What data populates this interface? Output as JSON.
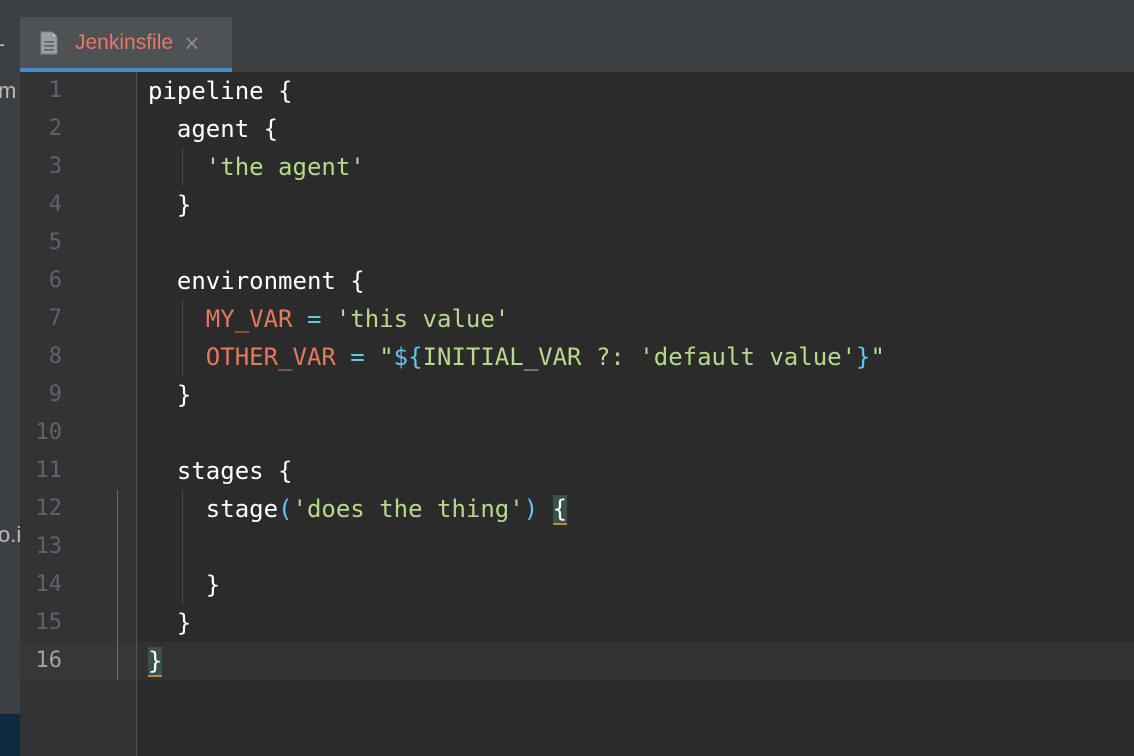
{
  "tabs": [
    {
      "title": "Jenkinsfile",
      "close": "×",
      "active": true
    }
  ],
  "left_panel": {
    "fragments": [
      "m",
      "o.i"
    ]
  },
  "editor": {
    "current_line": 16,
    "lines": [
      {
        "num": "1",
        "tokens": [
          [
            "plain",
            "pipeline {"
          ]
        ]
      },
      {
        "num": "2",
        "tokens": [
          [
            "plain",
            "  agent {"
          ]
        ]
      },
      {
        "num": "3",
        "tokens": [
          [
            "plain",
            "    "
          ],
          [
            "str",
            "'the agent'"
          ]
        ]
      },
      {
        "num": "4",
        "tokens": [
          [
            "plain",
            "  }"
          ]
        ]
      },
      {
        "num": "5",
        "tokens": []
      },
      {
        "num": "6",
        "tokens": [
          [
            "plain",
            "  environment {"
          ]
        ]
      },
      {
        "num": "7",
        "tokens": [
          [
            "plain",
            "    "
          ],
          [
            "var",
            "MY_VAR"
          ],
          [
            "plain",
            " "
          ],
          [
            "op",
            "="
          ],
          [
            "plain",
            " "
          ],
          [
            "str",
            "'this value'"
          ]
        ]
      },
      {
        "num": "8",
        "tokens": [
          [
            "plain",
            "    "
          ],
          [
            "var",
            "OTHER_VAR"
          ],
          [
            "plain",
            " "
          ],
          [
            "op",
            "="
          ],
          [
            "plain",
            " "
          ],
          [
            "str",
            "\""
          ],
          [
            "op",
            "${"
          ],
          [
            "str",
            "INITIAL_VAR ?: 'default value'"
          ],
          [
            "op",
            "}"
          ],
          [
            "str",
            "\""
          ]
        ]
      },
      {
        "num": "9",
        "tokens": [
          [
            "plain",
            "  }"
          ]
        ]
      },
      {
        "num": "10",
        "tokens": []
      },
      {
        "num": "11",
        "tokens": [
          [
            "plain",
            "  stages {"
          ]
        ]
      },
      {
        "num": "12",
        "tokens": [
          [
            "plain",
            "    stage"
          ],
          [
            "op",
            "("
          ],
          [
            "str",
            "'does the thing'"
          ],
          [
            "op",
            ")"
          ],
          [
            "plain",
            " "
          ],
          [
            "hl",
            "{"
          ]
        ]
      },
      {
        "num": "13",
        "tokens": []
      },
      {
        "num": "14",
        "tokens": [
          [
            "plain",
            "    }"
          ]
        ]
      },
      {
        "num": "15",
        "tokens": [
          [
            "plain",
            "  }"
          ]
        ]
      },
      {
        "num": "16",
        "tokens": [
          [
            "hl",
            "}"
          ]
        ]
      }
    ]
  },
  "colors": {
    "background": "#2b2b2b",
    "string": "#b6d98b",
    "variable": "#e4795e",
    "operator": "#5fc7f2",
    "tab_accent": "#4a88c7",
    "tab_title": "#e77865"
  }
}
